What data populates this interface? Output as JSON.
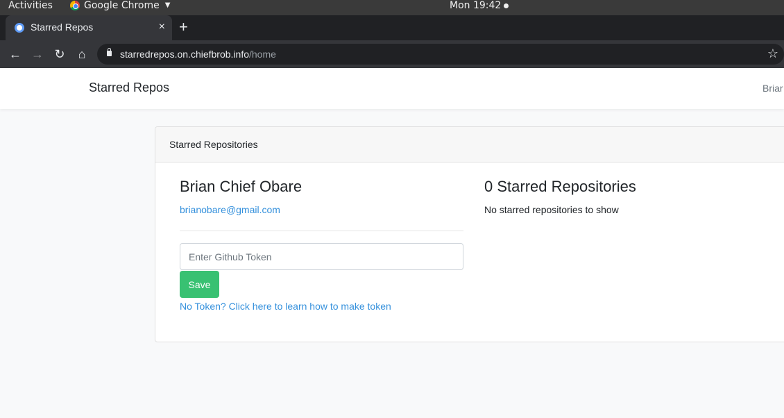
{
  "os_bar": {
    "activities_label": "Activities",
    "app_name": "Google Chrome",
    "clock": "Mon 19:42"
  },
  "browser": {
    "tab_title": "Starred Repos",
    "tab_close": "×",
    "new_tab": "+",
    "url_host": "starredrepos.on.chiefbrob.info",
    "url_path": "/home",
    "icons": [
      "back-icon",
      "forward-icon",
      "reload-icon",
      "home-icon",
      "lock-icon",
      "bookmark-star-icon"
    ]
  },
  "navbar": {
    "brand": "Starred Repos",
    "user": "Briar"
  },
  "card": {
    "header": "Starred Repositories",
    "user_name": "Brian Chief Obare",
    "user_email": "brianobare@gmail.com",
    "token_placeholder": "Enter Github Token",
    "token_value": "",
    "save_label": "Save",
    "token_help_link": "No Token? Click here to learn how to make token",
    "repo_count_title": "0 Starred Repositories",
    "repo_empty_message": "No starred repositories to show"
  },
  "colors": {
    "primary_link": "#3490dc",
    "success": "#38c172",
    "page_bg": "#f8f9fa"
  }
}
